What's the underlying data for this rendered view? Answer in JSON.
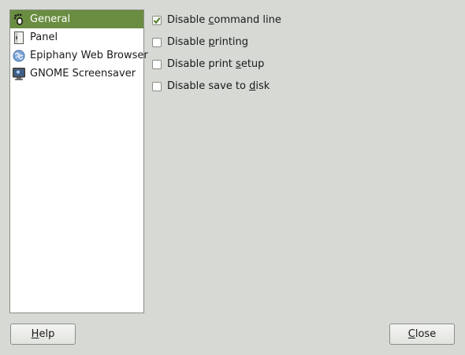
{
  "sidebar": {
    "items": [
      {
        "label": "General",
        "icon": "gnome-foot-icon",
        "selected": true
      },
      {
        "label": "Panel",
        "icon": "panel-icon",
        "selected": false
      },
      {
        "label": "Epiphany Web Browser",
        "icon": "globe-icon",
        "selected": false
      },
      {
        "label": "GNOME Screensaver",
        "icon": "monitor-icon",
        "selected": false
      }
    ]
  },
  "options": [
    {
      "label": "Disable command line",
      "mnemonic": "c",
      "checked": true
    },
    {
      "label": "Disable printing",
      "mnemonic": "p",
      "checked": false
    },
    {
      "label": "Disable print setup",
      "mnemonic": "s",
      "checked": false
    },
    {
      "label": "Disable save to disk",
      "mnemonic": "d",
      "checked": false
    }
  ],
  "buttons": {
    "help": {
      "label": "Help",
      "mnemonic": "H"
    },
    "close": {
      "label": "Close",
      "mnemonic": "C"
    }
  },
  "colors": {
    "selection": "#6a8d41",
    "window_bg": "#d6d9d4",
    "check_green": "#4e7a27"
  }
}
